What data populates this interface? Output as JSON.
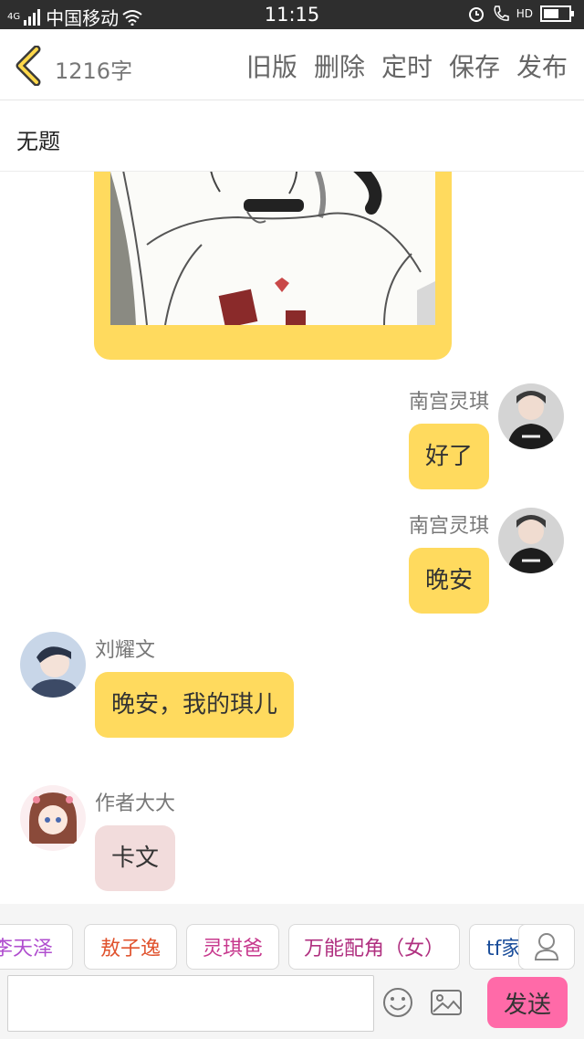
{
  "status_bar": {
    "network": "4G",
    "carrier": "中国移动",
    "time": "11:15",
    "hd": "HD"
  },
  "header": {
    "word_count": "1216字",
    "actions": [
      "旧版",
      "删除",
      "定时",
      "保存",
      "发布"
    ]
  },
  "title": "无题",
  "messages": [
    {
      "sender": "南宫灵琪",
      "text": "好了"
    },
    {
      "sender": "南宫灵琪",
      "text": "晚安"
    },
    {
      "sender": "刘耀文",
      "text": "晚安，我的琪儿"
    },
    {
      "sender": "作者大大",
      "text": "卡文"
    }
  ],
  "roles": [
    {
      "label": "李天泽",
      "color": "#b04fcf"
    },
    {
      "label": "敖子逸",
      "color": "#e0532e"
    },
    {
      "label": "灵琪爸",
      "color": "#c7388d"
    },
    {
      "label": "万能配角（女）",
      "color": "#b03080"
    },
    {
      "label": "tf家",
      "color": "#1a4d9a"
    }
  ],
  "input": {
    "placeholder": "",
    "send_label": "发送"
  },
  "colors": {
    "accent_yellow": "#ffda5e",
    "author_bubble": "#f2dcdc",
    "send_pink": "#ff6aa8"
  }
}
